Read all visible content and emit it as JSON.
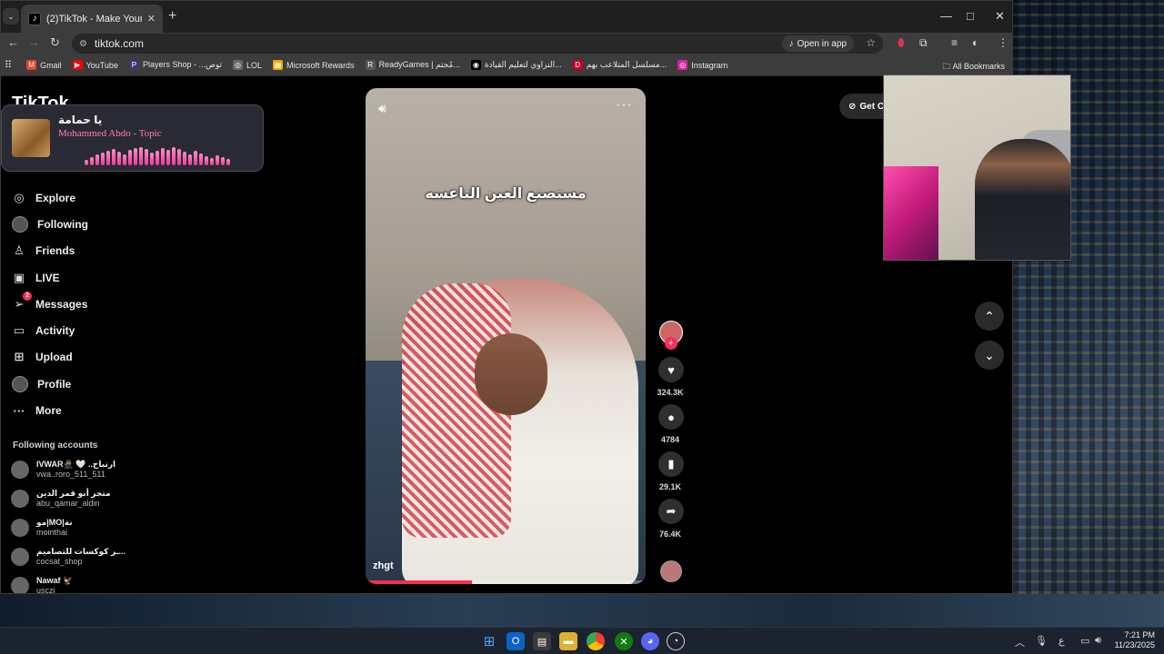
{
  "browser": {
    "tab_title": "(2)TikTok - Make Your Day",
    "tab_favicon": "♪",
    "tab_close": "✕",
    "new_tab": "+",
    "minimize": "—",
    "maximize": "□",
    "close": "✕",
    "url": "tiktok.com",
    "open_in_app": "Open in app"
  },
  "bookmarks": [
    {
      "label": "Gmail",
      "icon": "M",
      "color": "#ea4335"
    },
    {
      "label": "YouTube",
      "icon": "▶",
      "color": "#ff0000"
    },
    {
      "label": "Players Shop - ...توص",
      "icon": "P",
      "color": "#3b3b6b"
    },
    {
      "label": "LOL",
      "icon": "◎",
      "color": "#666"
    },
    {
      "label": "Microsoft Rewards",
      "icon": "▦",
      "color": "#f2a900"
    },
    {
      "label": "ReadyGames | مُجتم...",
      "icon": "R",
      "color": "#555"
    },
    {
      "label": "النزاوي لتعليم القيادة...",
      "icon": "◉",
      "color": "#000"
    },
    {
      "label": "مسلسل المتلاعب بهم...",
      "icon": "D",
      "color": "#c4002a"
    },
    {
      "label": "Instagram",
      "icon": "◎",
      "color": "#d6249f"
    }
  ],
  "all_bookmarks": "All Bookmarks",
  "logo": "TikTok",
  "now_playing": {
    "title": "يا حمامة",
    "artist": "Mohammed Abdo - Topic"
  },
  "nav": [
    {
      "label": "Explore",
      "icon": "◎"
    },
    {
      "label": "Following",
      "icon": "avatar"
    },
    {
      "label": "Friends",
      "icon": "♙"
    },
    {
      "label": "LIVE",
      "icon": "▣"
    },
    {
      "label": "Messages",
      "icon": "➢",
      "badge": "2"
    },
    {
      "label": "Activity",
      "icon": "▭"
    },
    {
      "label": "Upload",
      "icon": "⊞"
    },
    {
      "label": "Profile",
      "icon": "avatar"
    },
    {
      "label": "More",
      "icon": "···"
    }
  ],
  "following_title": "Following accounts",
  "following": [
    {
      "name": "IVWAR🥷🏽 🤍 ..ارتباح",
      "handle": "vwa..roro_511_511"
    },
    {
      "name": "متجر أبو قمر الدين",
      "handle": "abu_qamar_aldin"
    },
    {
      "name": "مو|MO|نة",
      "handle": "mointhai"
    },
    {
      "name": "ـر كوكسات للتصاميم...",
      "handle": "cocsat_shop"
    },
    {
      "name": "Nawaf 🦅",
      "handle": "usczi"
    }
  ],
  "video": {
    "caption": "مستصنع العين الناعسه",
    "username": "zhgt",
    "progress": 0.38
  },
  "actions": {
    "likes": "324.3K",
    "comments": "4784",
    "saves": "29.1K",
    "shares": "76.4K"
  },
  "get_coins_partial": "Get C",
  "taskbar": {
    "time": "7:21 PM",
    "date": "11/23/2025",
    "lang": "ع"
  }
}
